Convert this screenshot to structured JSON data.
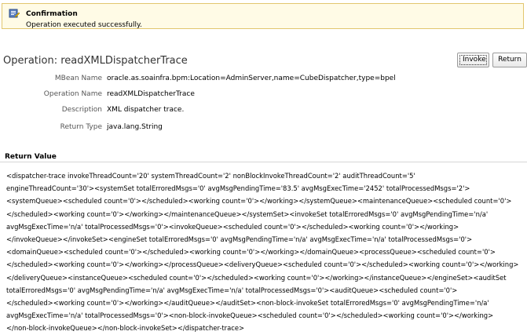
{
  "confirmation": {
    "icon": "edit-document-icon",
    "title": "Confirmation",
    "message": "Operation executed successfully."
  },
  "operation": {
    "title": "Operation: readXMLDispatcherTrace",
    "invoke_label": "Invoke",
    "return_label": "Return"
  },
  "fields": {
    "mbean_label": "MBean Name",
    "mbean_value": "oracle.as.soainfra.bpm:Location=AdminServer,name=CubeDispatcher,type=bpel",
    "opname_label": "Operation Name",
    "opname_value": "readXMLDispatcherTrace",
    "desc_label": "Description",
    "desc_value": "XML dispatcher trace.",
    "rtype_label": "Return Type",
    "rtype_value": "java.lang.String"
  },
  "return_value": {
    "title": "Return Value",
    "lines": [
      "<dispatcher-trace invokeThreadCount='20' systemThreadCount='2' nonBlockInvokeThreadCount='2' auditThreadCount='5'",
      "engineThreadCount='30'><systemSet totalErroredMsgs='0' avgMsgPendingTime='83.5' avgMsgExecTime='2452' totalProcessedMsgs='2'>",
      "<systemQueue><scheduled count='0'></scheduled><working count='0'></working></systemQueue><maintenanceQueue><scheduled count='0'>",
      "</scheduled><working count='0'></working></maintenanceQueue></systemSet><invokeSet totalErroredMsgs='0' avgMsgPendingTime='n/a'",
      "avgMsgExecTime='n/a' totalProcessedMsgs='0'><invokeQueue><scheduled count='0'></scheduled><working count='0'></working>",
      "</invokeQueue></invokeSet><engineSet totalErroredMsgs='0' avgMsgPendingTime='n/a' avgMsgExecTime='n/a' totalProcessedMsgs='0'>",
      "<domainQueue><scheduled count='0'></scheduled><working count='0'></working></domainQueue><processQueue><scheduled count='0'>",
      "</scheduled><working count='0'></working></processQueue><deliveryQueue><scheduled count='0'></scheduled><working count='0'></working>",
      "</deliveryQueue><instanceQueue><scheduled count='0'></scheduled><working count='0'></working></instanceQueue></engineSet><auditSet",
      "totalErroredMsgs='0' avgMsgPendingTime='n/a' avgMsgExecTime='n/a' totalProcessedMsgs='0'><auditQueue><scheduled count='0'>",
      "</scheduled><working count='0'></working></auditQueue></auditSet><non-block-invokeSet totalErroredMsgs='0' avgMsgPendingTime='n/a'",
      "avgMsgExecTime='n/a' totalProcessedMsgs='0'><non-block-invokeQueue><scheduled count='0'></scheduled><working count='0'></working>",
      "</non-block-invokeQueue></non-block-invokeSet></dispatcher-trace>"
    ]
  }
}
